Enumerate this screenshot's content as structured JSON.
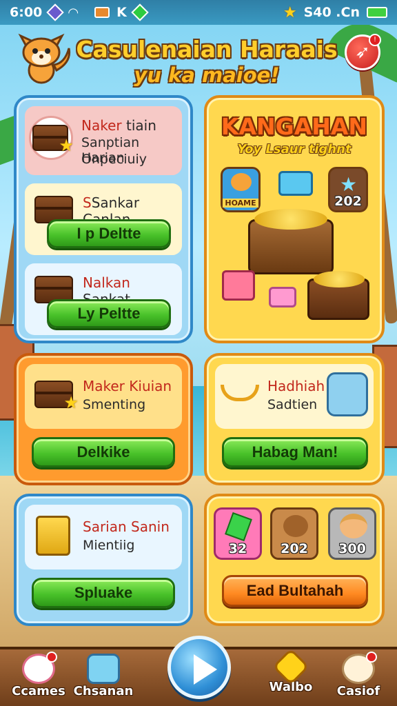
{
  "status": {
    "time": "6:00",
    "left_text": "K",
    "right_text": "S40 .Cn"
  },
  "header": {
    "title_line1": "Casulenaian Haraais",
    "title_line2": "yu ka maioe!"
  },
  "panel_left": {
    "card1": {
      "title_prefix": "Naker",
      "title_rest": " tiain",
      "line2": "Sanptian Harian",
      "line3": "Onpeciuiy"
    },
    "card2": {
      "title": "Sankar Canlan",
      "button": "I p Deltte"
    },
    "card3": {
      "title_prefix": "Nalkan",
      "title_rest": " Sankat",
      "button": "Ly Peltte"
    }
  },
  "promo": {
    "title": "KANGAHAN",
    "subtitle": "Yoy Lsaur tighnt",
    "tile_left_label": "HOAME",
    "tile_right_label": "202"
  },
  "panel_mid_left": {
    "title": "Maker Kiuian",
    "subtitle": "Smenting",
    "button": "Delkike"
  },
  "panel_mid_right": {
    "title": "Hadhiah",
    "subtitle": "Sadtien",
    "button": "Habag Man!"
  },
  "panel_bot_left": {
    "title": "Sarian Sanin",
    "subtitle": "Mientiig",
    "button": "Spluake"
  },
  "panel_bot_right": {
    "tiles": [
      {
        "value": "32"
      },
      {
        "value": "202"
      },
      {
        "value": "300"
      }
    ],
    "button": "Ead Bultahah"
  },
  "bottom_nav": [
    {
      "label": "Ccames",
      "icon": "cat-icon"
    },
    {
      "label": "Chsanan",
      "icon": "map-icon"
    },
    {
      "label": "Walbo",
      "icon": "star-shield-icon"
    },
    {
      "label": "Casiof",
      "icon": "flower-icon"
    }
  ],
  "colors": {
    "accent_green": "#49c22a",
    "accent_orange": "#ff8a22",
    "panel_blue": "#9fd8f5",
    "panel_gold": "#ffd84f"
  }
}
